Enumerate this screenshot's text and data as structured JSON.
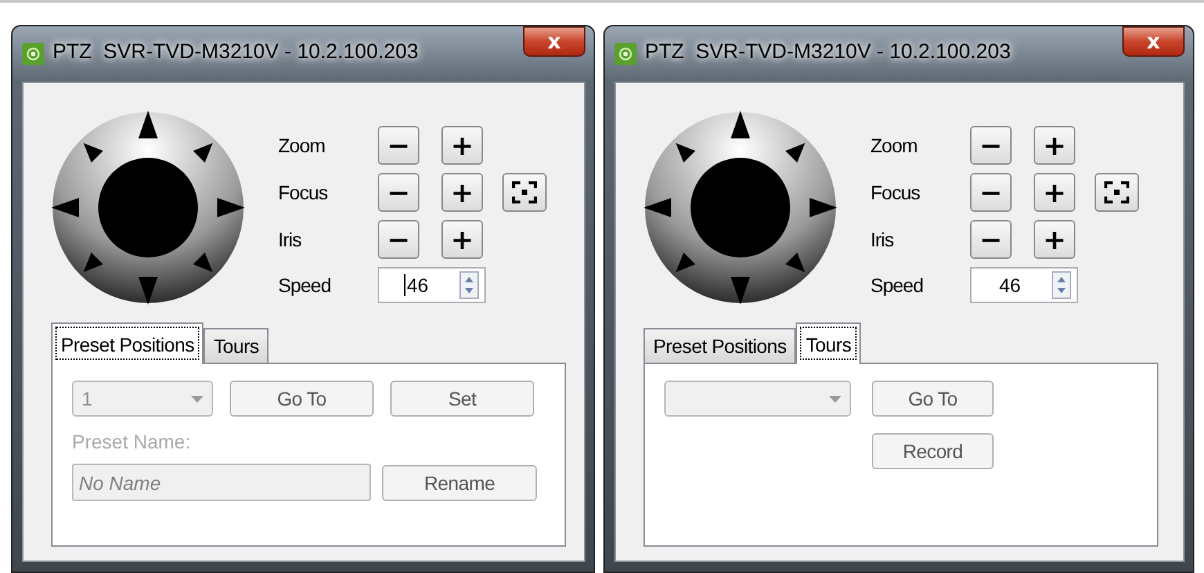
{
  "windows": [
    {
      "title": "PTZ  SVR-TVD-M3210V - 10.2.100.203",
      "close": "x",
      "controls": [
        {
          "label": "Zoom",
          "minus": "−",
          "plus": "+"
        },
        {
          "label": "Focus",
          "minus": "−",
          "plus": "+",
          "focus_area": true
        },
        {
          "label": "Iris",
          "minus": "−",
          "plus": "+"
        }
      ],
      "speed": {
        "label": "Speed",
        "value": "46",
        "caret": true
      },
      "tabs": [
        {
          "label": "Preset Positions",
          "selected": true
        },
        {
          "label": "Tours",
          "selected": false
        }
      ],
      "panel": {
        "kind": "presets",
        "dropdown": "1",
        "buttons": [
          "Go To",
          "Set"
        ],
        "name_label": "Preset Name:",
        "name_value": "No Name",
        "rename": "Rename",
        "disabled": true
      }
    },
    {
      "title": "PTZ  SVR-TVD-M3210V - 10.2.100.203",
      "close": "x",
      "controls": [
        {
          "label": "Zoom",
          "minus": "−",
          "plus": "+"
        },
        {
          "label": "Focus",
          "minus": "−",
          "plus": "+",
          "focus_area": true
        },
        {
          "label": "Iris",
          "minus": "−",
          "plus": "+"
        }
      ],
      "speed": {
        "label": "Speed",
        "value": "46",
        "caret": false
      },
      "tabs": [
        {
          "label": "Preset Positions",
          "selected": false
        },
        {
          "label": "Tours",
          "selected": true
        }
      ],
      "panel": {
        "kind": "tours",
        "buttons": [
          "Go To",
          "Record"
        ],
        "disabled": true
      }
    }
  ]
}
